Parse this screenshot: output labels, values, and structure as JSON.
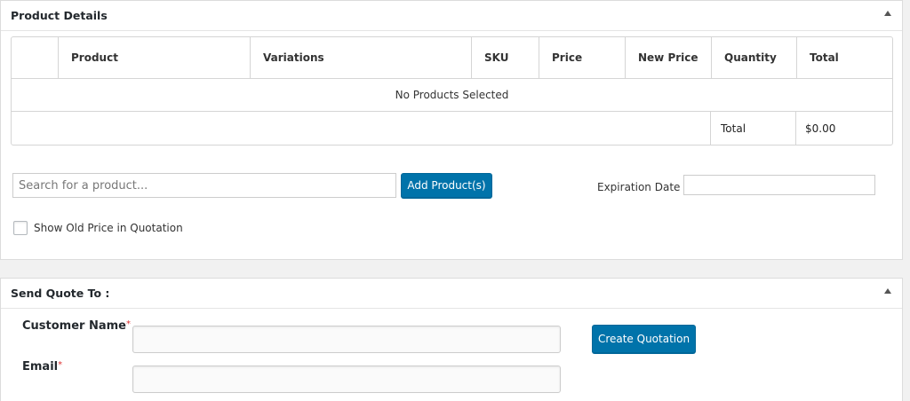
{
  "product_details": {
    "title": "Product Details",
    "columns": [
      "",
      "Product",
      "Variations",
      "SKU",
      "Price",
      "New Price",
      "Quantity",
      "Total"
    ],
    "empty_message": "No Products Selected",
    "total_label": "Total",
    "total_value": "$0.00",
    "search_placeholder": "Search for a product...",
    "add_button": "Add Product(s)",
    "expiration_label": "Expiration Date :",
    "show_old_price_label": "Show Old Price in Quotation"
  },
  "send_quote": {
    "title": "Send Quote To :",
    "customer_name_label": "Customer Name",
    "email_label": "Email",
    "required_mark": "*",
    "create_button": "Create Quotation"
  },
  "icons": {
    "collapse": "triangle-up-icon"
  },
  "colors": {
    "primary_button": "#0073aa",
    "required": "#dc3232"
  }
}
